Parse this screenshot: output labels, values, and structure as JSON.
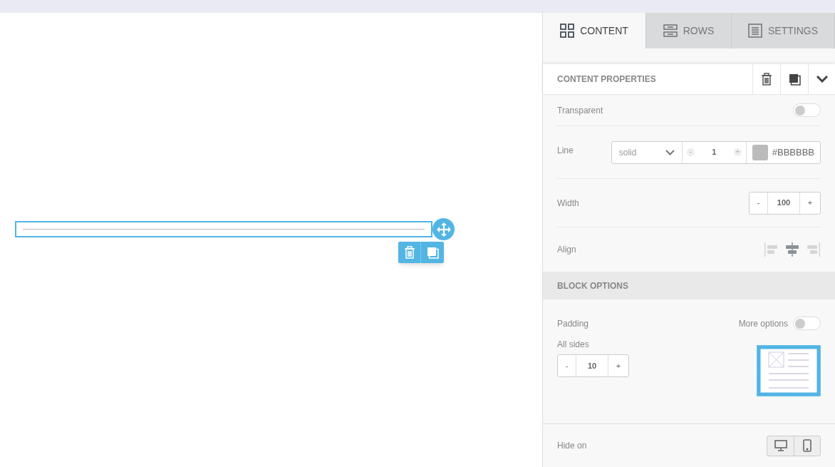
{
  "tabs": [
    {
      "kind": "grid",
      "label": "CONTENT",
      "selected": true
    },
    {
      "kind": "rows",
      "label": "ROWS",
      "selected": false
    },
    {
      "kind": "doc",
      "label": "SETTINGS",
      "selected": false
    }
  ],
  "content_properties": {
    "title": "CONTENT PROPERTIES",
    "transparent": {
      "label": "Transparent",
      "on": false
    },
    "line": {
      "label": "Line",
      "style": "solid",
      "thickness": {
        "minus": "-",
        "value": "1",
        "plus": "+"
      },
      "color": "#bbbbbb",
      "color_text": "#BBBBBB"
    },
    "width": {
      "label": "Width",
      "minus": "-",
      "value": "100",
      "plus": "+"
    },
    "align": {
      "label": "Align",
      "options": [
        {
          "kind": "left",
          "selected": false
        },
        {
          "kind": "center",
          "selected": true
        },
        {
          "kind": "right",
          "selected": false
        }
      ]
    }
  },
  "block_options": {
    "title": "BLOCK OPTIONS",
    "padding": {
      "label": "Padding",
      "more_options": {
        "label": "More options",
        "on": false
      },
      "all_sides": {
        "label": "All sides",
        "minus": "-",
        "value": "10",
        "plus": "+"
      }
    },
    "hide_on": {
      "label": "Hide on",
      "devices": [
        {
          "kind": "desktop"
        },
        {
          "kind": "mobile"
        }
      ]
    }
  }
}
